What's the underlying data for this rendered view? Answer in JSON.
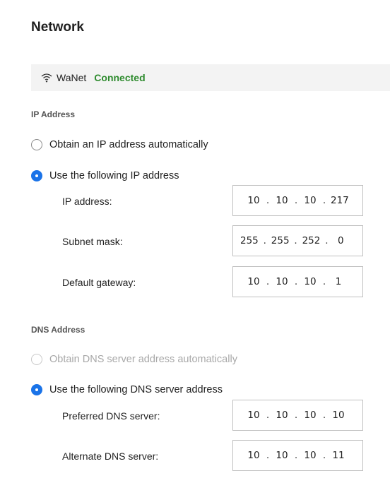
{
  "header": {
    "title": "Network"
  },
  "connection": {
    "wifi_icon": "wifi-icon",
    "ssid": "WaNet",
    "status": "Connected",
    "status_color": "#2e8b2e"
  },
  "ip_section": {
    "label": "IP Address",
    "option_auto": {
      "label": "Obtain an IP address automatically",
      "selected": false
    },
    "option_manual": {
      "label": "Use the following IP address",
      "selected": true
    },
    "fields": {
      "ip_address": {
        "label": "IP address:",
        "octets": [
          "10",
          "10",
          "10",
          "217"
        ]
      },
      "subnet_mask": {
        "label": "Subnet mask:",
        "octets": [
          "255",
          "255",
          "252",
          "0"
        ]
      },
      "default_gateway": {
        "label": "Default gateway:",
        "octets": [
          "10",
          "10",
          "10",
          "1"
        ]
      }
    }
  },
  "dns_section": {
    "label": "DNS Address",
    "option_auto": {
      "label": "Obtain DNS server address automatically",
      "selected": false,
      "disabled": true
    },
    "option_manual": {
      "label": "Use the following DNS server address",
      "selected": true
    },
    "fields": {
      "preferred": {
        "label": "Preferred DNS server:",
        "octets": [
          "10",
          "10",
          "10",
          "10"
        ]
      },
      "alternate": {
        "label": "Alternate DNS server:",
        "octets": [
          "10",
          "10",
          "10",
          "11"
        ]
      }
    }
  },
  "accent_color": "#1a73e8"
}
